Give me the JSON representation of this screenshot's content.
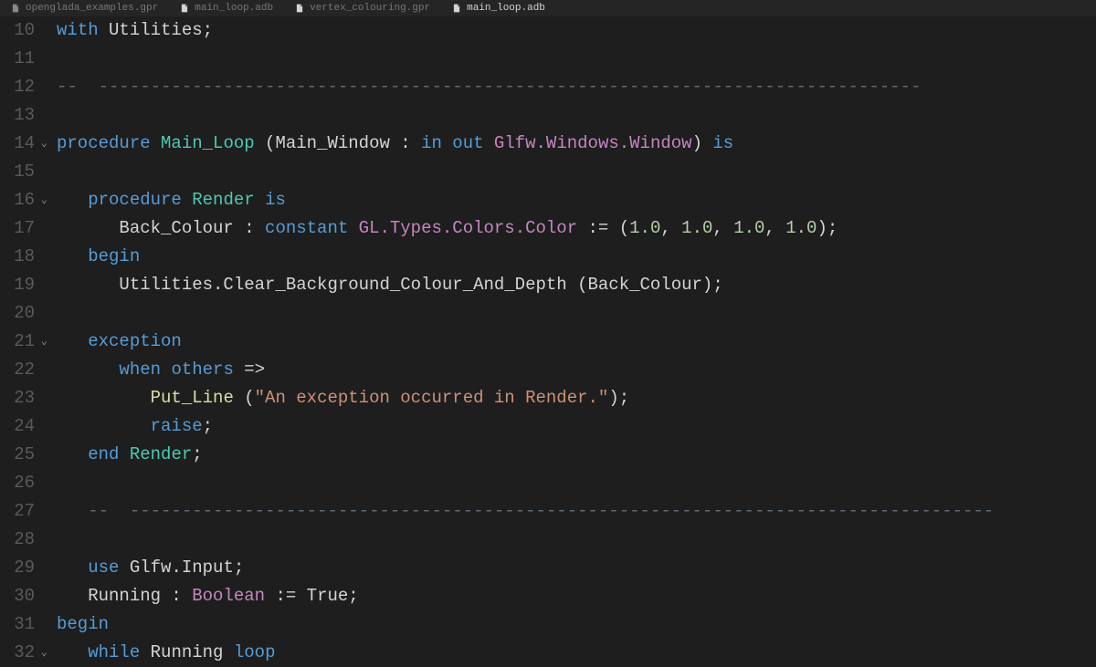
{
  "tabs": [
    {
      "label": "openglada_examples.gpr",
      "active": false
    },
    {
      "label": "main_loop.adb",
      "active": false
    },
    {
      "label": "vertex_colouring.gpr",
      "active": false
    },
    {
      "label": "main_loop.adb",
      "active": true
    }
  ],
  "startLine": 10,
  "foldLines": [
    14,
    16,
    21,
    32
  ],
  "code": [
    [
      {
        "t": "kw",
        "v": "with"
      },
      {
        "t": "txt",
        "v": " Utilities;"
      }
    ],
    [],
    [
      {
        "t": "comment",
        "v": "--  -------------------------------------------------------------------------------"
      }
    ],
    [],
    [
      {
        "t": "kw",
        "v": "procedure"
      },
      {
        "t": "txt",
        "v": " "
      },
      {
        "t": "proc-name",
        "v": "Main_Loop"
      },
      {
        "t": "txt",
        "v": " (Main_Window : "
      },
      {
        "t": "kw",
        "v": "in out"
      },
      {
        "t": "txt",
        "v": " "
      },
      {
        "t": "type",
        "v": "Glfw.Windows.Window"
      },
      {
        "t": "txt",
        "v": ") "
      },
      {
        "t": "kw",
        "v": "is"
      }
    ],
    [],
    [
      {
        "t": "txt",
        "v": "   "
      },
      {
        "t": "kw",
        "v": "procedure"
      },
      {
        "t": "txt",
        "v": " "
      },
      {
        "t": "proc-name",
        "v": "Render"
      },
      {
        "t": "txt",
        "v": " "
      },
      {
        "t": "kw",
        "v": "is"
      }
    ],
    [
      {
        "t": "txt",
        "v": "      Back_Colour : "
      },
      {
        "t": "kw",
        "v": "constant"
      },
      {
        "t": "txt",
        "v": " "
      },
      {
        "t": "type",
        "v": "GL.Types.Colors.Color"
      },
      {
        "t": "txt",
        "v": " := ("
      },
      {
        "t": "num",
        "v": "1.0"
      },
      {
        "t": "txt",
        "v": ", "
      },
      {
        "t": "num",
        "v": "1.0"
      },
      {
        "t": "txt",
        "v": ", "
      },
      {
        "t": "num",
        "v": "1.0"
      },
      {
        "t": "txt",
        "v": ", "
      },
      {
        "t": "num",
        "v": "1.0"
      },
      {
        "t": "txt",
        "v": ");"
      }
    ],
    [
      {
        "t": "txt",
        "v": "   "
      },
      {
        "t": "kw",
        "v": "begin"
      }
    ],
    [
      {
        "t": "txt",
        "v": "      Utilities.Clear_Background_Colour_And_Depth (Back_Colour);"
      }
    ],
    [],
    [
      {
        "t": "txt",
        "v": "   "
      },
      {
        "t": "kw",
        "v": "exception"
      }
    ],
    [
      {
        "t": "txt",
        "v": "      "
      },
      {
        "t": "kw",
        "v": "when"
      },
      {
        "t": "txt",
        "v": " "
      },
      {
        "t": "kw",
        "v": "others"
      },
      {
        "t": "txt",
        "v": " =>"
      }
    ],
    [
      {
        "t": "txt",
        "v": "         "
      },
      {
        "t": "fn-name",
        "v": "Put_Line"
      },
      {
        "t": "txt",
        "v": " ("
      },
      {
        "t": "str",
        "v": "\"An exception occurred in Render.\""
      },
      {
        "t": "txt",
        "v": ");"
      }
    ],
    [
      {
        "t": "txt",
        "v": "         "
      },
      {
        "t": "kw",
        "v": "raise"
      },
      {
        "t": "txt",
        "v": ";"
      }
    ],
    [
      {
        "t": "txt",
        "v": "   "
      },
      {
        "t": "kw",
        "v": "end"
      },
      {
        "t": "txt",
        "v": " "
      },
      {
        "t": "proc-name",
        "v": "Render"
      },
      {
        "t": "txt",
        "v": ";"
      }
    ],
    [],
    [
      {
        "t": "txt",
        "v": "   "
      },
      {
        "t": "comment",
        "v": "--  -----------------------------------------------------------------------------------"
      }
    ],
    [],
    [
      {
        "t": "txt",
        "v": "   "
      },
      {
        "t": "kw",
        "v": "use"
      },
      {
        "t": "txt",
        "v": " Glfw.Input;"
      }
    ],
    [
      {
        "t": "txt",
        "v": "   Running : "
      },
      {
        "t": "type",
        "v": "Boolean"
      },
      {
        "t": "txt",
        "v": " := True;"
      }
    ],
    [
      {
        "t": "kw",
        "v": "begin"
      }
    ],
    [
      {
        "t": "txt",
        "v": "   "
      },
      {
        "t": "kw",
        "v": "while"
      },
      {
        "t": "txt",
        "v": " Running "
      },
      {
        "t": "kw",
        "v": "loop"
      }
    ]
  ]
}
